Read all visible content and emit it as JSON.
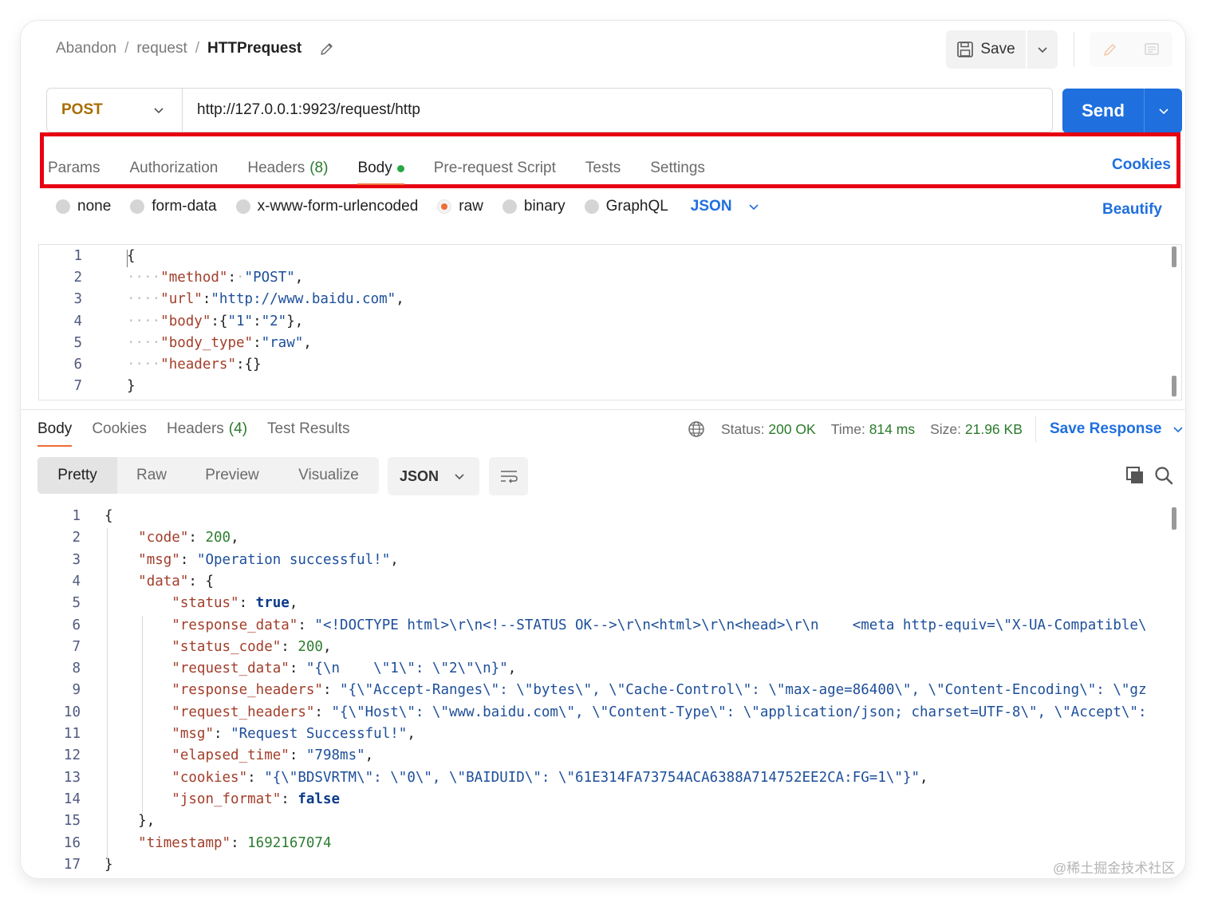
{
  "breadcrumb": {
    "workspace": "Abandon",
    "collection": "request",
    "request": "HTTPrequest",
    "separator": "/"
  },
  "toolbar": {
    "save_label": "Save"
  },
  "url_bar": {
    "method": "POST",
    "url": "http://127.0.0.1:9923/request/http",
    "send_label": "Send"
  },
  "request_tabs": [
    {
      "label": "Params"
    },
    {
      "label": "Authorization"
    },
    {
      "label": "Headers",
      "count": "(8)"
    },
    {
      "label": "Body",
      "active": true
    },
    {
      "label": "Pre-request Script"
    },
    {
      "label": "Tests"
    },
    {
      "label": "Settings"
    }
  ],
  "cookies_label": "Cookies",
  "body_types": [
    "none",
    "form-data",
    "x-www-form-urlencoded",
    "raw",
    "binary",
    "GraphQL"
  ],
  "body_type_selected": "raw",
  "body_format": "JSON",
  "beautify_label": "Beautify",
  "request_body": {
    "line_numbers": [
      "1",
      "2",
      "3",
      "4",
      "5",
      "6",
      "7"
    ],
    "lines": [
      [
        {
          "t": "p",
          "v": "{"
        }
      ],
      [
        {
          "t": "d",
          "v": "····"
        },
        {
          "t": "k",
          "v": "\"method\""
        },
        {
          "t": "p",
          "v": ":"
        },
        {
          "t": "d",
          "v": "·"
        },
        {
          "t": "s",
          "v": "\"POST\""
        },
        {
          "t": "p",
          "v": ","
        }
      ],
      [
        {
          "t": "d",
          "v": "····"
        },
        {
          "t": "k",
          "v": "\"url\""
        },
        {
          "t": "p",
          "v": ":"
        },
        {
          "t": "s",
          "v": "\"http://www.baidu.com\""
        },
        {
          "t": "p",
          "v": ","
        }
      ],
      [
        {
          "t": "d",
          "v": "····"
        },
        {
          "t": "k",
          "v": "\"body\""
        },
        {
          "t": "p",
          "v": ":{"
        },
        {
          "t": "s",
          "v": "\"1\""
        },
        {
          "t": "p",
          "v": ":"
        },
        {
          "t": "s",
          "v": "\"2\""
        },
        {
          "t": "p",
          "v": "},"
        }
      ],
      [
        {
          "t": "d",
          "v": "····"
        },
        {
          "t": "k",
          "v": "\"body_type\""
        },
        {
          "t": "p",
          "v": ":"
        },
        {
          "t": "s",
          "v": "\"raw\""
        },
        {
          "t": "p",
          "v": ","
        }
      ],
      [
        {
          "t": "d",
          "v": "····"
        },
        {
          "t": "k",
          "v": "\"headers\""
        },
        {
          "t": "p",
          "v": ":{}"
        }
      ],
      [
        {
          "t": "p",
          "v": "}"
        }
      ]
    ]
  },
  "response_tabs": [
    {
      "label": "Body",
      "active": true
    },
    {
      "label": "Cookies"
    },
    {
      "label": "Headers",
      "count": "(4)"
    },
    {
      "label": "Test Results"
    }
  ],
  "response_status": {
    "status_label": "Status:",
    "status_value": "200 OK",
    "time_label": "Time:",
    "time_value": "814 ms",
    "size_label": "Size:",
    "size_value": "21.96 KB"
  },
  "save_response_label": "Save Response",
  "view_modes": [
    "Pretty",
    "Raw",
    "Preview",
    "Visualize"
  ],
  "view_mode_active": "Pretty",
  "response_format": "JSON",
  "response_body": {
    "line_numbers": [
      "1",
      "2",
      "3",
      "4",
      "5",
      "6",
      "7",
      "8",
      "9",
      "10",
      "11",
      "12",
      "13",
      "14",
      "15",
      "16",
      "17"
    ],
    "lines": [
      [
        {
          "t": "p",
          "v": "{"
        }
      ],
      [
        {
          "t": "i",
          "v": "    "
        },
        {
          "t": "k",
          "v": "\"code\""
        },
        {
          "t": "p",
          "v": ": "
        },
        {
          "t": "n",
          "v": "200"
        },
        {
          "t": "p",
          "v": ","
        }
      ],
      [
        {
          "t": "i",
          "v": "    "
        },
        {
          "t": "k",
          "v": "\"msg\""
        },
        {
          "t": "p",
          "v": ": "
        },
        {
          "t": "s",
          "v": "\"Operation successful!\""
        },
        {
          "t": "p",
          "v": ","
        }
      ],
      [
        {
          "t": "i",
          "v": "    "
        },
        {
          "t": "k",
          "v": "\"data\""
        },
        {
          "t": "p",
          "v": ": {"
        }
      ],
      [
        {
          "t": "i",
          "v": "        "
        },
        {
          "t": "k",
          "v": "\"status\""
        },
        {
          "t": "p",
          "v": ": "
        },
        {
          "t": "b",
          "v": "true"
        },
        {
          "t": "p",
          "v": ","
        }
      ],
      [
        {
          "t": "i",
          "v": "        "
        },
        {
          "t": "k",
          "v": "\"response_data\""
        },
        {
          "t": "p",
          "v": ": "
        },
        {
          "t": "s",
          "v": "\"<!DOCTYPE html>\\r\\n<!--STATUS OK-->\\r\\n<html>\\r\\n<head>\\r\\n    <meta http-equiv=\\\"X-UA-Compatible\\"
        }
      ],
      [
        {
          "t": "i",
          "v": "        "
        },
        {
          "t": "k",
          "v": "\"status_code\""
        },
        {
          "t": "p",
          "v": ": "
        },
        {
          "t": "n",
          "v": "200"
        },
        {
          "t": "p",
          "v": ","
        }
      ],
      [
        {
          "t": "i",
          "v": "        "
        },
        {
          "t": "k",
          "v": "\"request_data\""
        },
        {
          "t": "p",
          "v": ": "
        },
        {
          "t": "s",
          "v": "\"{\\n    \\\"1\\\": \\\"2\\\"\\n}\""
        },
        {
          "t": "p",
          "v": ","
        }
      ],
      [
        {
          "t": "i",
          "v": "        "
        },
        {
          "t": "k",
          "v": "\"response_headers\""
        },
        {
          "t": "p",
          "v": ": "
        },
        {
          "t": "s",
          "v": "\"{\\\"Accept-Ranges\\\": \\\"bytes\\\", \\\"Cache-Control\\\": \\\"max-age=86400\\\", \\\"Content-Encoding\\\": \\\"gz"
        }
      ],
      [
        {
          "t": "i",
          "v": "        "
        },
        {
          "t": "k",
          "v": "\"request_headers\""
        },
        {
          "t": "p",
          "v": ": "
        },
        {
          "t": "s",
          "v": "\"{\\\"Host\\\": \\\"www.baidu.com\\\", \\\"Content-Type\\\": \\\"application/json; charset=UTF-8\\\", \\\"Accept\\\":"
        }
      ],
      [
        {
          "t": "i",
          "v": "        "
        },
        {
          "t": "k",
          "v": "\"msg\""
        },
        {
          "t": "p",
          "v": ": "
        },
        {
          "t": "s",
          "v": "\"Request Successful!\""
        },
        {
          "t": "p",
          "v": ","
        }
      ],
      [
        {
          "t": "i",
          "v": "        "
        },
        {
          "t": "k",
          "v": "\"elapsed_time\""
        },
        {
          "t": "p",
          "v": ": "
        },
        {
          "t": "s",
          "v": "\"798ms\""
        },
        {
          "t": "p",
          "v": ","
        }
      ],
      [
        {
          "t": "i",
          "v": "        "
        },
        {
          "t": "k",
          "v": "\"cookies\""
        },
        {
          "t": "p",
          "v": ": "
        },
        {
          "t": "s",
          "v": "\"{\\\"BDSVRTM\\\": \\\"0\\\", \\\"BAIDUID\\\": \\\"61E314FA73754ACA6388A714752EE2CA:FG=1\\\"}\""
        },
        {
          "t": "p",
          "v": ","
        }
      ],
      [
        {
          "t": "i",
          "v": "        "
        },
        {
          "t": "k",
          "v": "\"json_format\""
        },
        {
          "t": "p",
          "v": ": "
        },
        {
          "t": "b",
          "v": "false"
        }
      ],
      [
        {
          "t": "i",
          "v": "    "
        },
        {
          "t": "p",
          "v": "},"
        }
      ],
      [
        {
          "t": "i",
          "v": "    "
        },
        {
          "t": "k",
          "v": "\"timestamp\""
        },
        {
          "t": "p",
          "v": ": "
        },
        {
          "t": "n",
          "v": "1692167074"
        }
      ],
      [
        {
          "t": "p",
          "v": "}"
        }
      ]
    ]
  },
  "watermark": "@稀土掘金技术社区",
  "colors": {
    "accent": "#1f6fde",
    "method": "#a86d00",
    "highlight_box": "#e60012",
    "active_tab": "#ef6c35",
    "dot": "#27a844"
  }
}
